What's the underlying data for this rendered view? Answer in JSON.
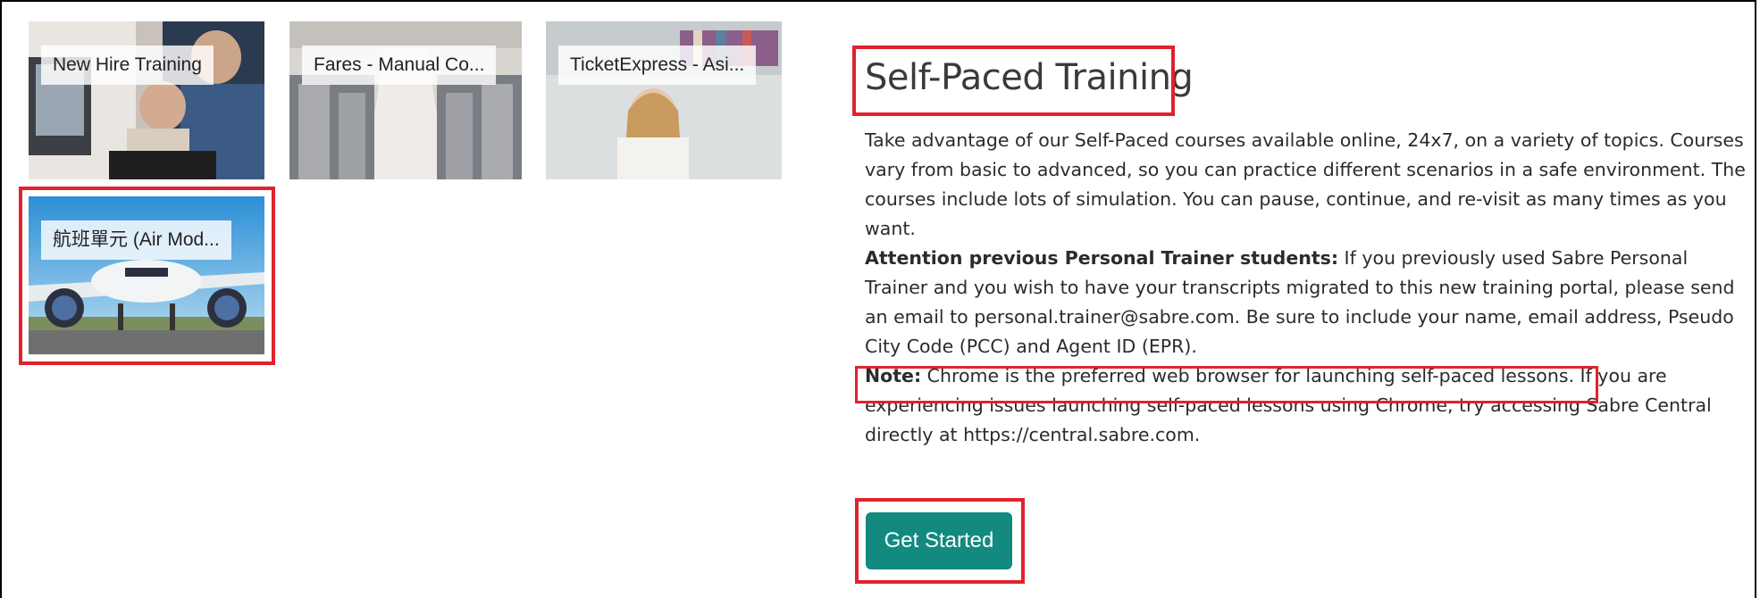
{
  "courses": [
    {
      "label": "New Hire Training",
      "icon": "office-training-photo"
    },
    {
      "label": "Fares - Manual Co...",
      "icon": "airplane-cabin-photo"
    },
    {
      "label": "TicketExpress - Asi...",
      "icon": "presenter-photo"
    },
    {
      "label": "航班單元 (Air Mod...",
      "icon": "airplane-runway-photo"
    }
  ],
  "section": {
    "title": "Self-Paced Training",
    "intro": "Take advantage of our Self-Paced courses available online, 24x7, on a variety of topics. Courses vary from basic to advanced, so you can practice different scenarios in a safe environment. The courses include lots of simulation. You can pause, continue, and re-visit as many times as you want.",
    "attention_label": "Attention previous Personal Trainer students:",
    "attention_text": " If you previously used Sabre Personal Trainer and you wish to have your transcripts migrated to this new training portal, please send an email to personal.trainer@sabre.com. Be sure to include your name, email address, Pseudo City Code (PCC) and Agent ID (EPR).",
    "note_label": "Note:",
    "note_text": " Chrome is the preferred web browser for launching self-paced lessons.",
    "note_rest": " If you are experiencing issues launching self-paced lessons using Chrome, try accessing Sabre Central directly at https://central.sabre.com.",
    "button_label": "Get Started"
  },
  "colors": {
    "button": "#138a80",
    "highlight": "#e0222e"
  }
}
